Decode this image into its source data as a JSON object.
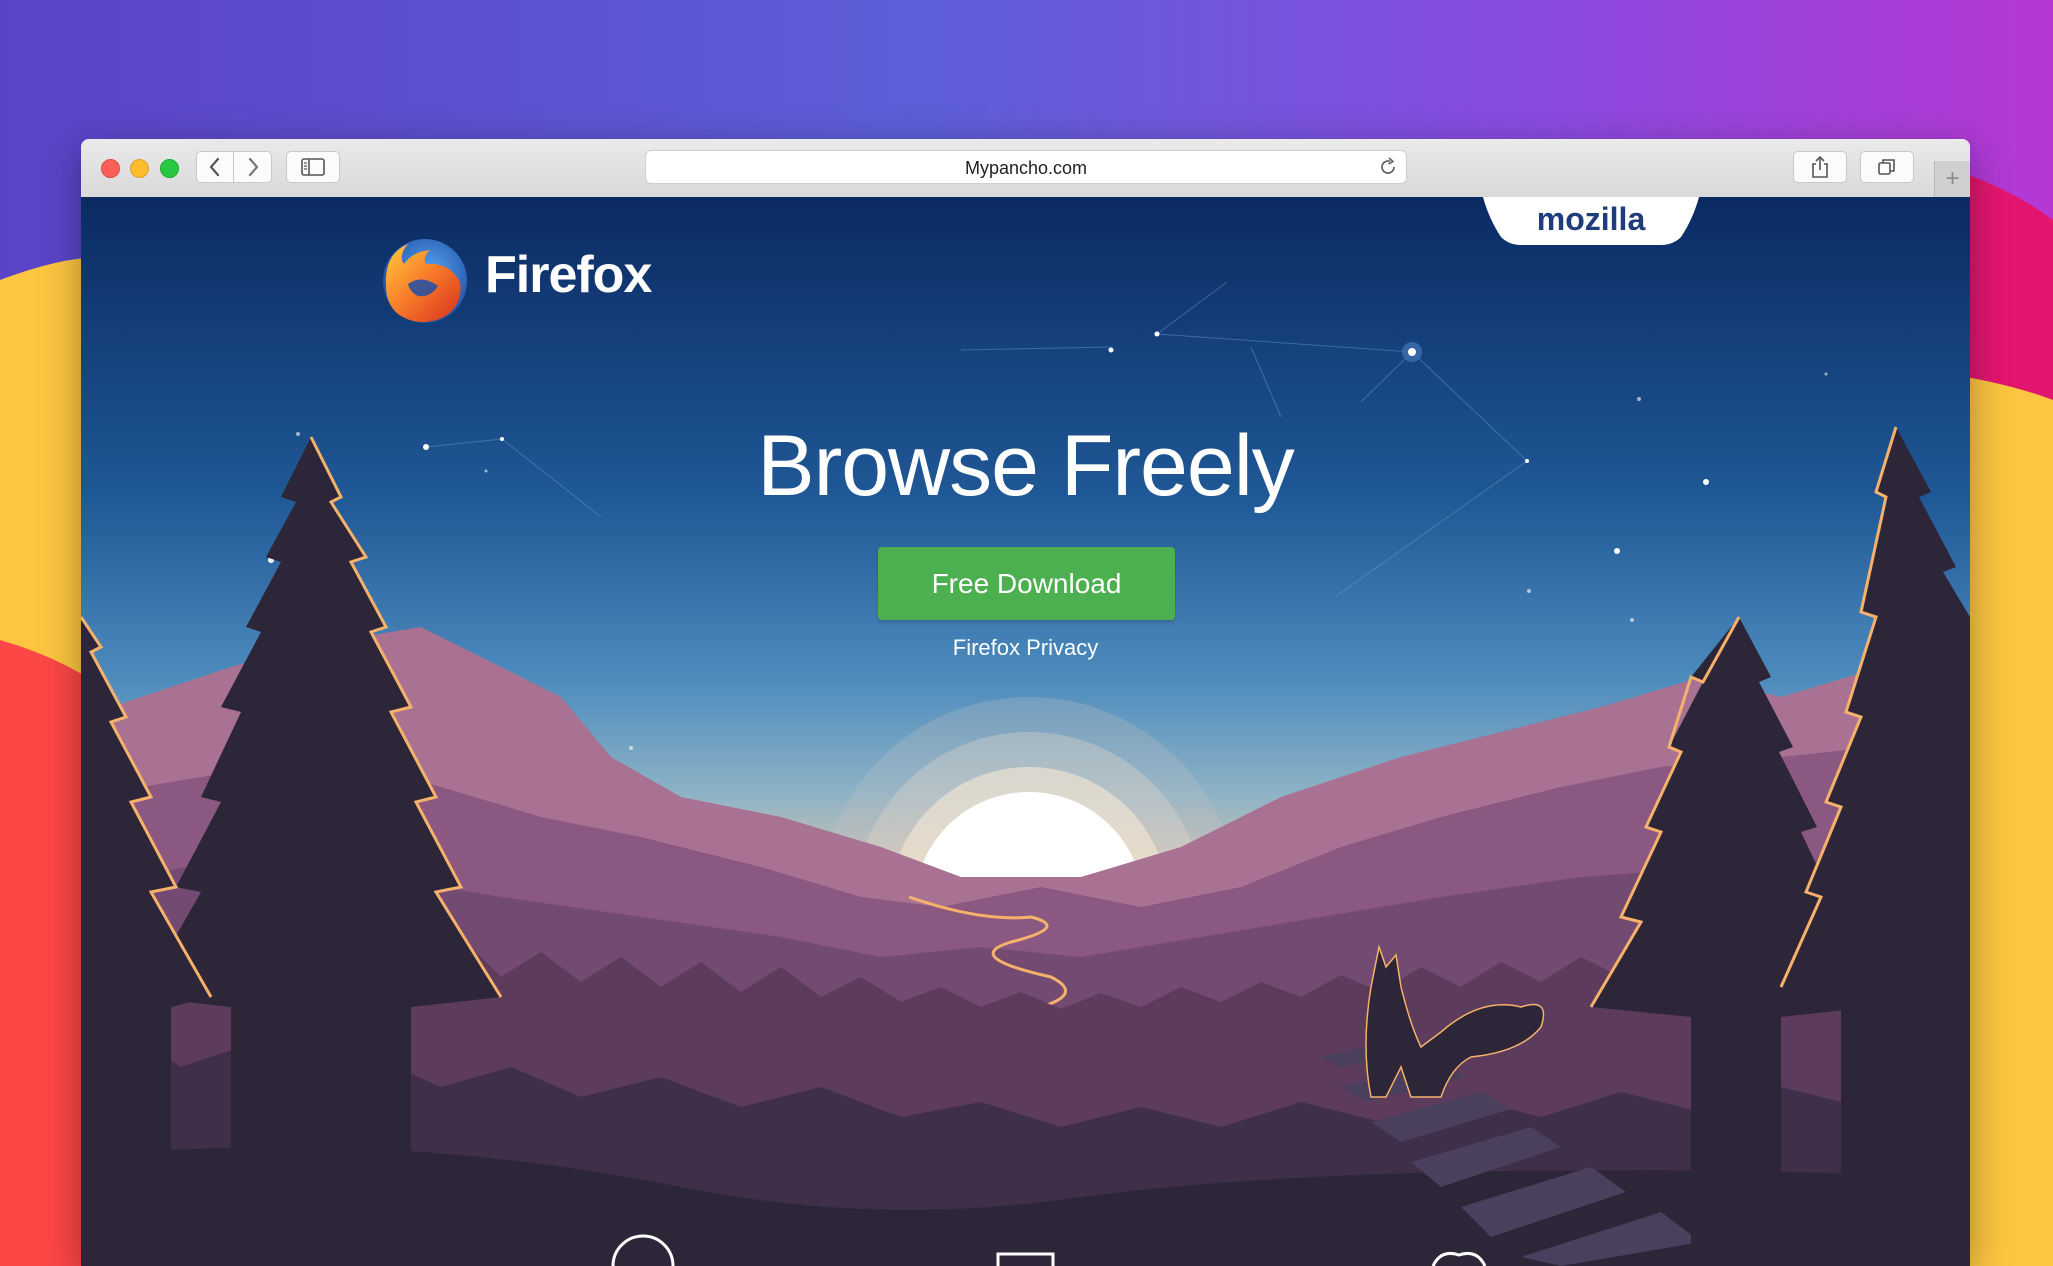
{
  "browser": {
    "url": "Mypancho.com",
    "new_tab_glyph": "+",
    "icons": [
      "back-icon",
      "forward-icon",
      "sidebar-icon",
      "reload-icon",
      "share-icon",
      "tabs-overview-icon"
    ]
  },
  "page": {
    "brand_tab": "mozilla",
    "product_name": "Firefox",
    "headline": "Browse Freely",
    "download_label": "Free Download",
    "privacy_link": "Firefox Privacy"
  },
  "colors": {
    "download_button": "#4caf50",
    "sky_top": "#0c2c66",
    "sky_bottom": "#d8bfa8",
    "mountains": "#7a4a75",
    "trees": "#2d2638",
    "accent_gold": "#f6b26b"
  }
}
